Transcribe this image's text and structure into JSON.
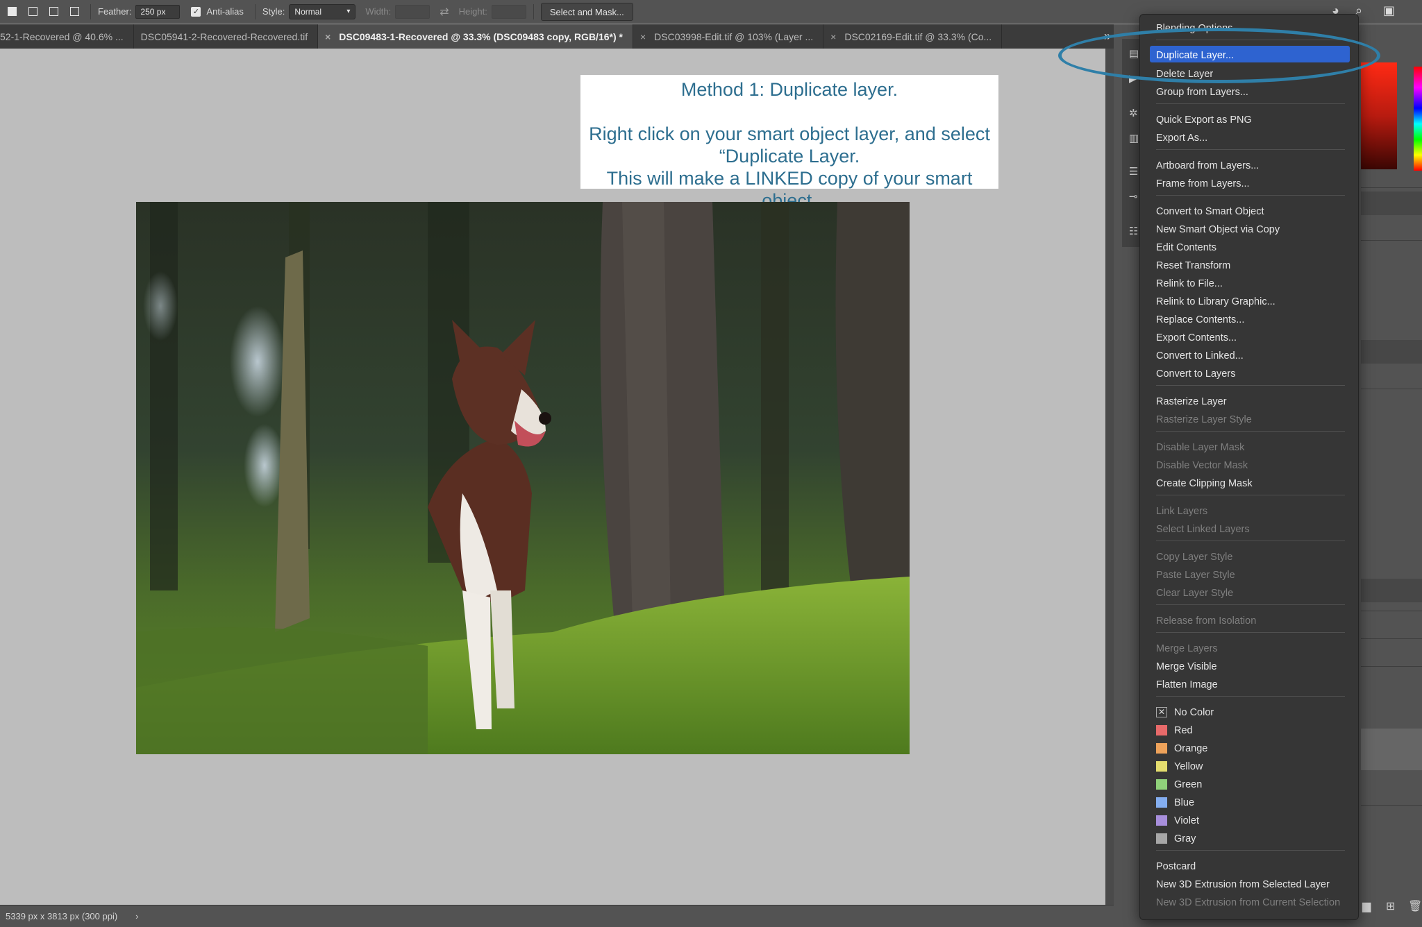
{
  "options_bar": {
    "feather_label": "Feather:",
    "feather_value": "250 px",
    "antialias_label": "Anti-alias",
    "style_label": "Style:",
    "style_value": "Normal",
    "width_label": "Width:",
    "height_label": "Height:",
    "select_mask_button": "Select and Mask..."
  },
  "tabs": [
    {
      "label": "52-1-Recovered @ 40.6% ...",
      "active": false
    },
    {
      "label": "DSC05941-2-Recovered-Recovered.tif",
      "active": false
    },
    {
      "label": "DSC09483-1-Recovered @ 33.3% (DSC09483 copy, RGB/16*) *",
      "active": true
    },
    {
      "label": "DSC03998-Edit.tif @ 103% (Layer ...",
      "active": false
    },
    {
      "label": "DSC02169-Edit.tif @ 33.3% (Co...",
      "active": false
    }
  ],
  "caption": {
    "line1": "Method 1: Duplicate layer.",
    "line2": "Right click on your smart object layer, and select",
    "line3": "“Duplicate Layer.",
    "line4": "This will make a LINKED copy of your smart object."
  },
  "status": {
    "doc_info": "5339 px x 3813 px (300 ppi)"
  },
  "menu": {
    "blending_options": "Blending Options...",
    "duplicate_layer": "Duplicate Layer...",
    "delete_layer": "Delete Layer",
    "group_from_layers": "Group from Layers...",
    "quick_export_png": "Quick Export as PNG",
    "export_as": "Export As...",
    "artboard_from_layers": "Artboard from Layers...",
    "frame_from_layers": "Frame from Layers...",
    "convert_to_smart_object": "Convert to Smart Object",
    "new_smart_object_via_copy": "New Smart Object via Copy",
    "edit_contents": "Edit Contents",
    "reset_transform": "Reset Transform",
    "relink_to_file": "Relink to File...",
    "relink_to_library_graphic": "Relink to Library Graphic...",
    "replace_contents": "Replace Contents...",
    "export_contents": "Export Contents...",
    "convert_to_linked": "Convert to Linked...",
    "convert_to_layers": "Convert to Layers",
    "rasterize_layer": "Rasterize Layer",
    "rasterize_layer_style": "Rasterize Layer Style",
    "disable_layer_mask": "Disable Layer Mask",
    "disable_vector_mask": "Disable Vector Mask",
    "create_clipping_mask": "Create Clipping Mask",
    "link_layers": "Link Layers",
    "select_linked_layers": "Select Linked Layers",
    "copy_layer_style": "Copy Layer Style",
    "paste_layer_style": "Paste Layer Style",
    "clear_layer_style": "Clear Layer Style",
    "release_from_isolation": "Release from Isolation",
    "merge_layers": "Merge Layers",
    "merge_visible": "Merge Visible",
    "flatten_image": "Flatten Image",
    "no_color": "No Color",
    "red": "Red",
    "orange": "Orange",
    "yellow": "Yellow",
    "green": "Green",
    "blue": "Blue",
    "violet": "Violet",
    "gray": "Gray",
    "postcard": "Postcard",
    "new_3d_extrusion_selected": "New 3D Extrusion from Selected Layer",
    "new_3d_extrusion_current": "New 3D Extrusion from Current Selection"
  },
  "colors": {
    "highlight": "#2e63d0",
    "annotation_oval": "#2f7fa8",
    "caption_text": "#2d6e8f",
    "swatch_red": "#e86a6a",
    "swatch_orange": "#eea25a",
    "swatch_yellow": "#e4dd6e",
    "swatch_green": "#8fd17a",
    "swatch_blue": "#84aef0",
    "swatch_violet": "#a88fdc",
    "swatch_gray": "#a7a7a7"
  }
}
